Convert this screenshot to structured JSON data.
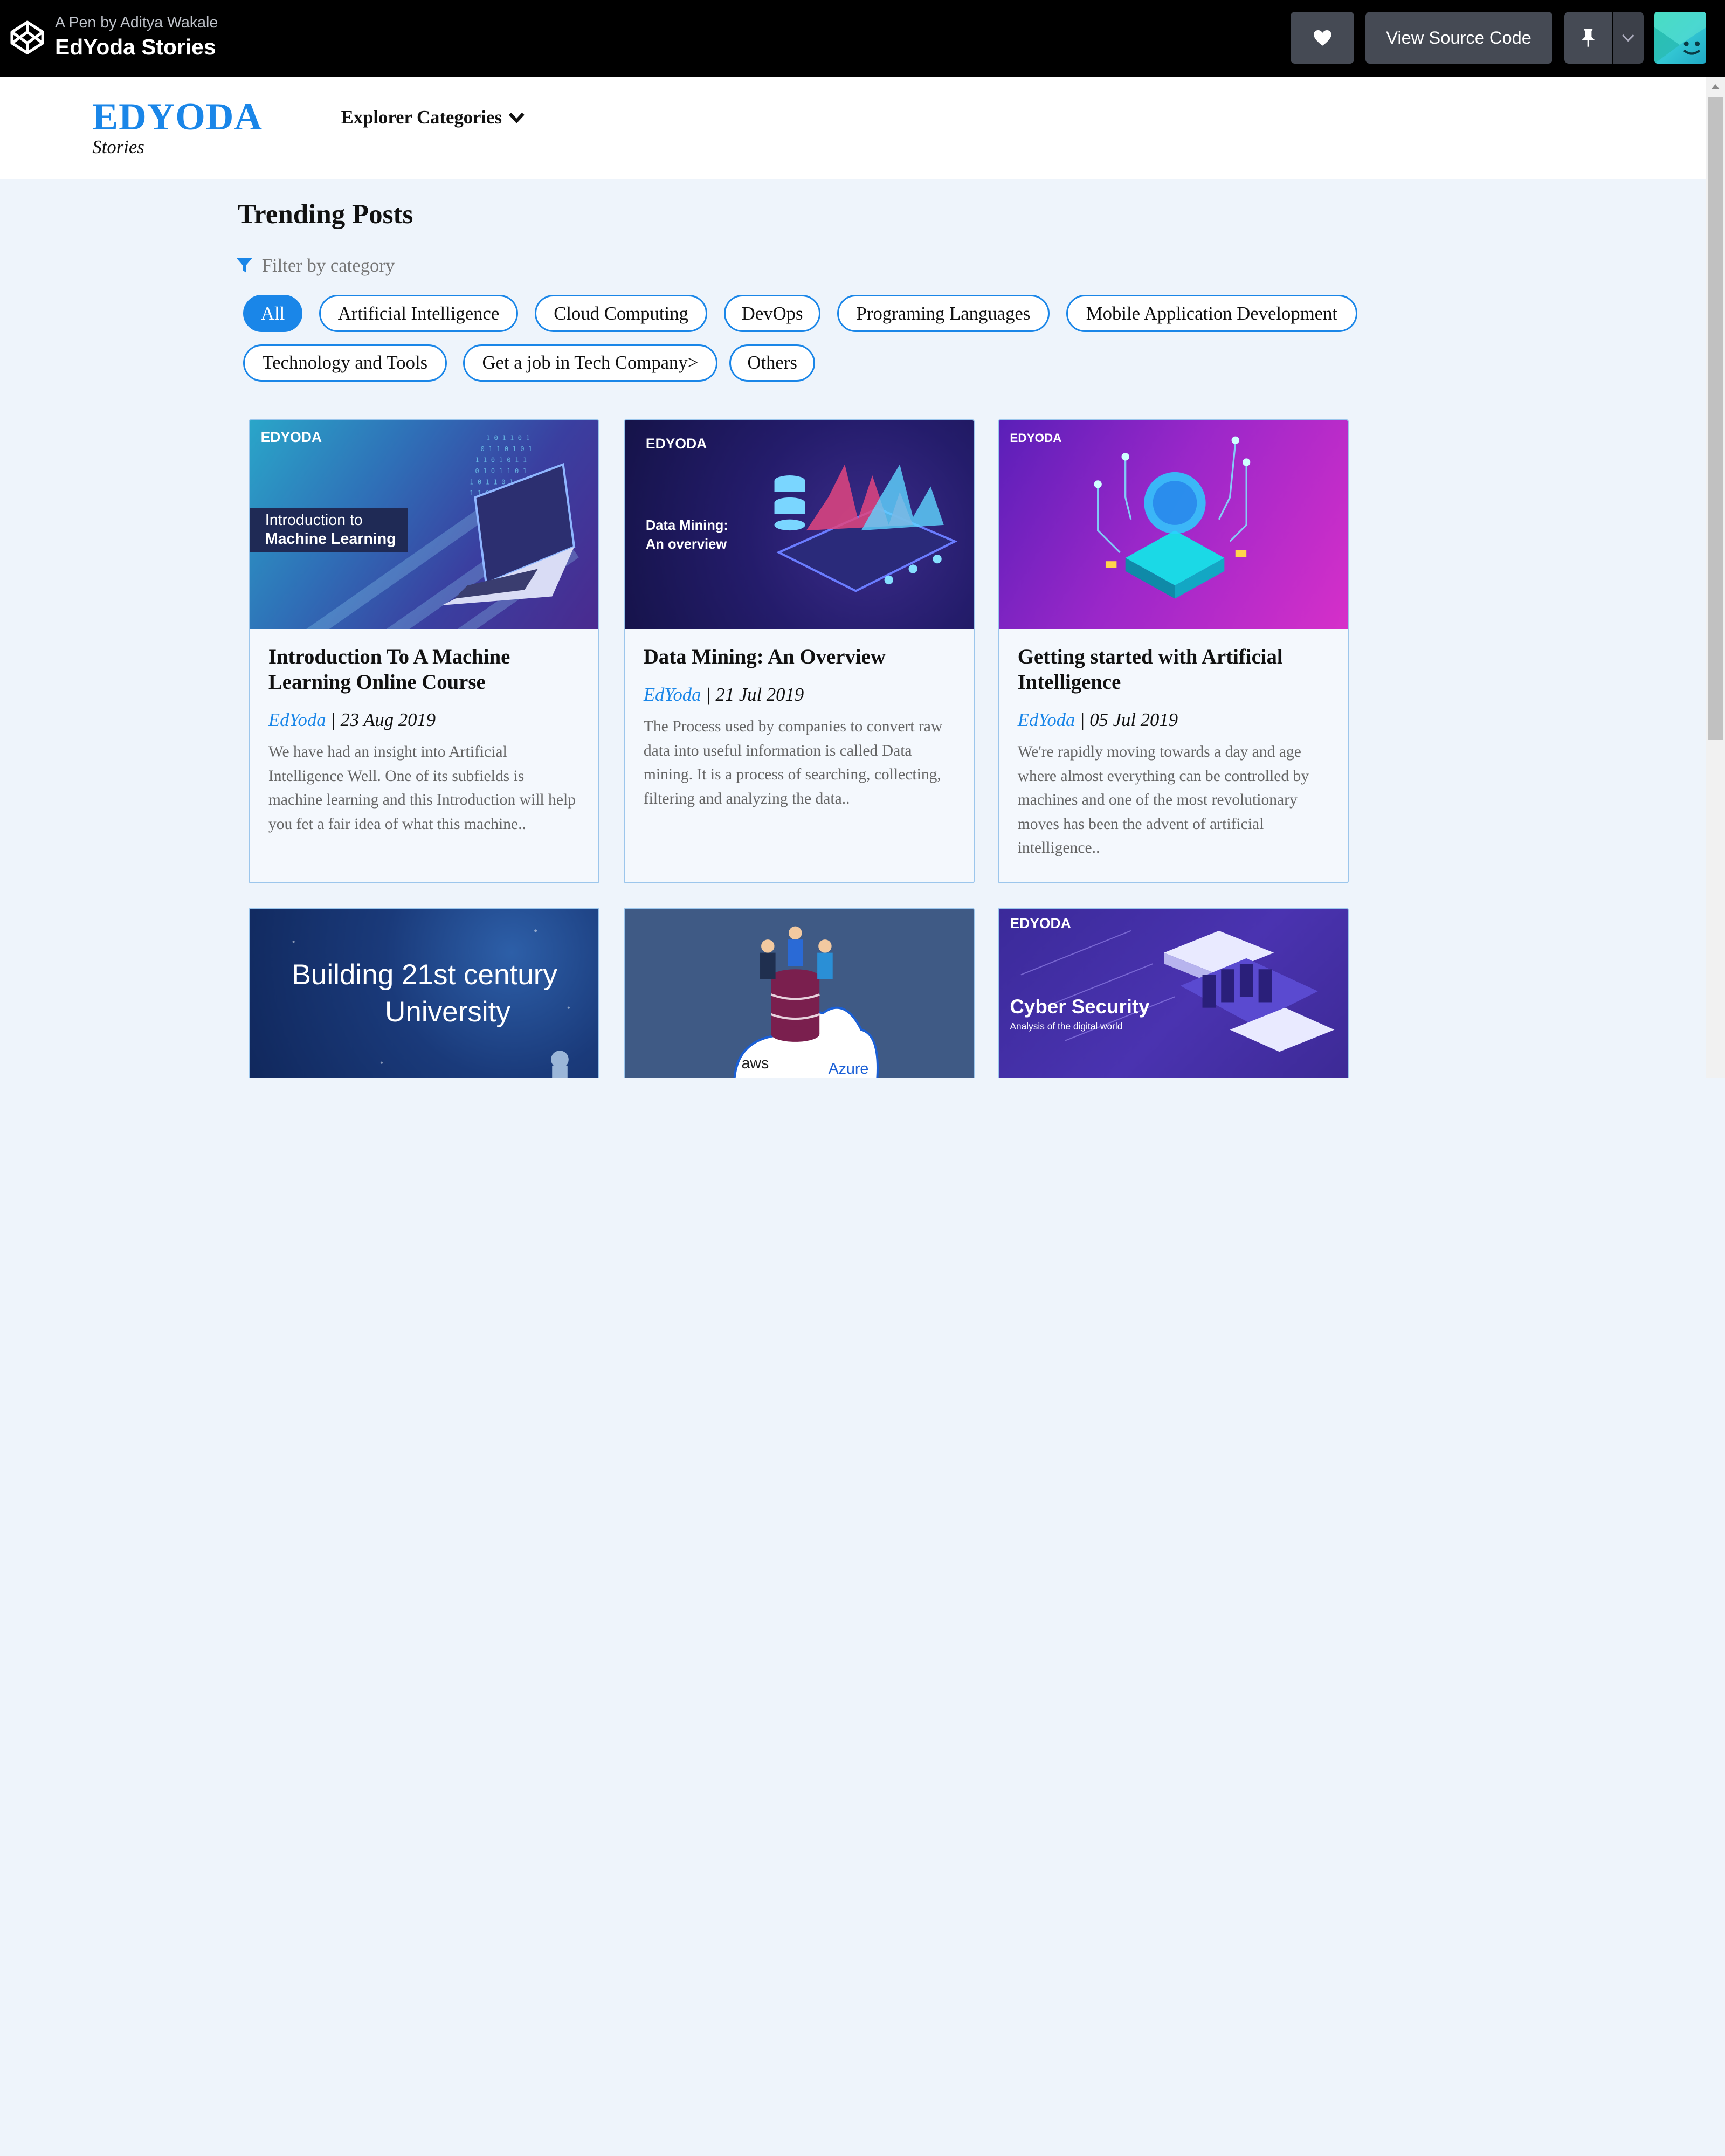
{
  "codepen": {
    "byline": "A Pen by Aditya Wakale",
    "title": "EdYoda Stories",
    "view_source": "View Source Code",
    "icons": [
      "codepen-logo-icon",
      "heart-icon",
      "pin-icon",
      "chevron-down-icon"
    ]
  },
  "header": {
    "brand": "EDYODA",
    "brand_sub": "Stories",
    "explore": "Explorer Categories"
  },
  "trending": {
    "title": "Trending Posts",
    "filter_label": "Filter by category",
    "categories": [
      "All",
      "Artificial Intelligence",
      "Cloud Computing",
      "DevOps",
      "Programing Languages",
      "Mobile Application Development",
      "Technology and Tools",
      "Get a job in Tech Company>",
      "Others"
    ],
    "active_category": "All"
  },
  "posts": [
    {
      "title": "Introduction To A Machine Learning Online Course",
      "author": "EdYoda",
      "date": "23 Aug 2019",
      "excerpt": "We have had an insight into Artificial Intelligence Well. One of its subfields is machine learning and this Introduction will help you fet a fair idea of what this machine..",
      "thumb_brand": "EDYODA",
      "thumb_line1": "Introduction to",
      "thumb_line2": "Machine Learning"
    },
    {
      "title": "Data Mining: An Overview",
      "author": "EdYoda",
      "date": "21 Jul 2019",
      "excerpt": "The Process used by companies to convert raw data into useful information is called Data mining. It is a process of searching, collecting, filtering and analyzing the data..",
      "thumb_brand": "EDYODA",
      "thumb_line1": "Data Mining:",
      "thumb_line2": "An overview"
    },
    {
      "title": "Getting started with Artificial Intelligence",
      "author": "EdYoda",
      "date": "05 Jul 2019",
      "excerpt": "We're rapidly moving towards a day and age where almost everything can be controlled by machines and one of the most revolutionary moves has been the advent of artificial intelligence..",
      "thumb_brand": "EDYODA"
    },
    {
      "thumb_line1": "Building 21st century",
      "thumb_line2": "University"
    },
    {
      "thumb_aws": "aws",
      "thumb_azure": "Azure"
    },
    {
      "thumb_brand": "EDYODA",
      "thumb_line1": "Cyber Security",
      "thumb_line2": "Analysis of the digital world"
    }
  ],
  "colors": {
    "accent": "#1a86e8",
    "page_bg": "#eef4fb",
    "card_border": "#9cc6ec",
    "topbar": "#000000"
  }
}
